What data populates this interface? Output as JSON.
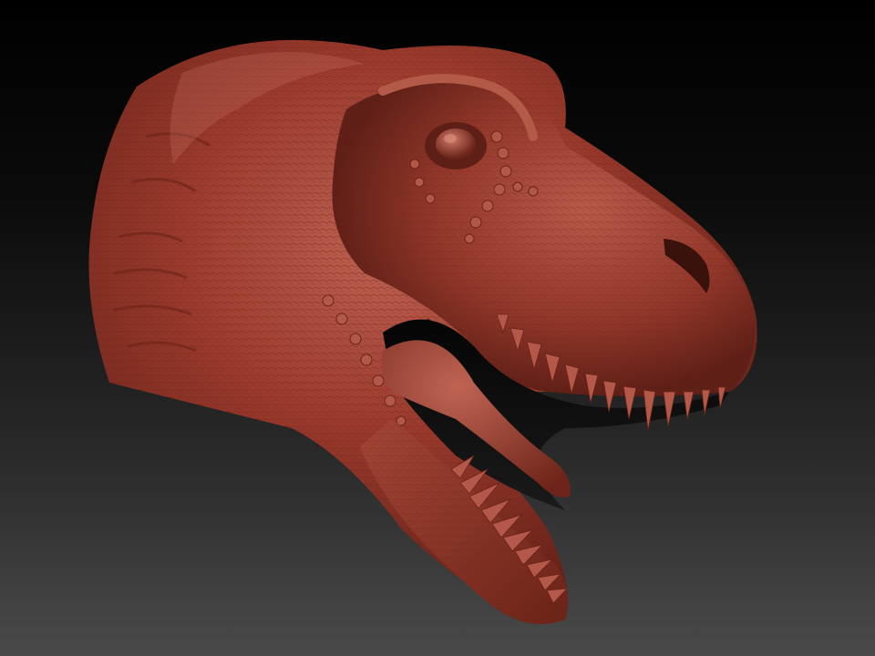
{
  "viewport": {
    "background_top": "#000000",
    "background_bottom": "#4a4a4a"
  },
  "model": {
    "subject": "t-rex-head-sculpt-icon",
    "material_color": "#9a3a2c",
    "shadow_color": "#5a1c14",
    "highlight_color": "#c46a58"
  }
}
